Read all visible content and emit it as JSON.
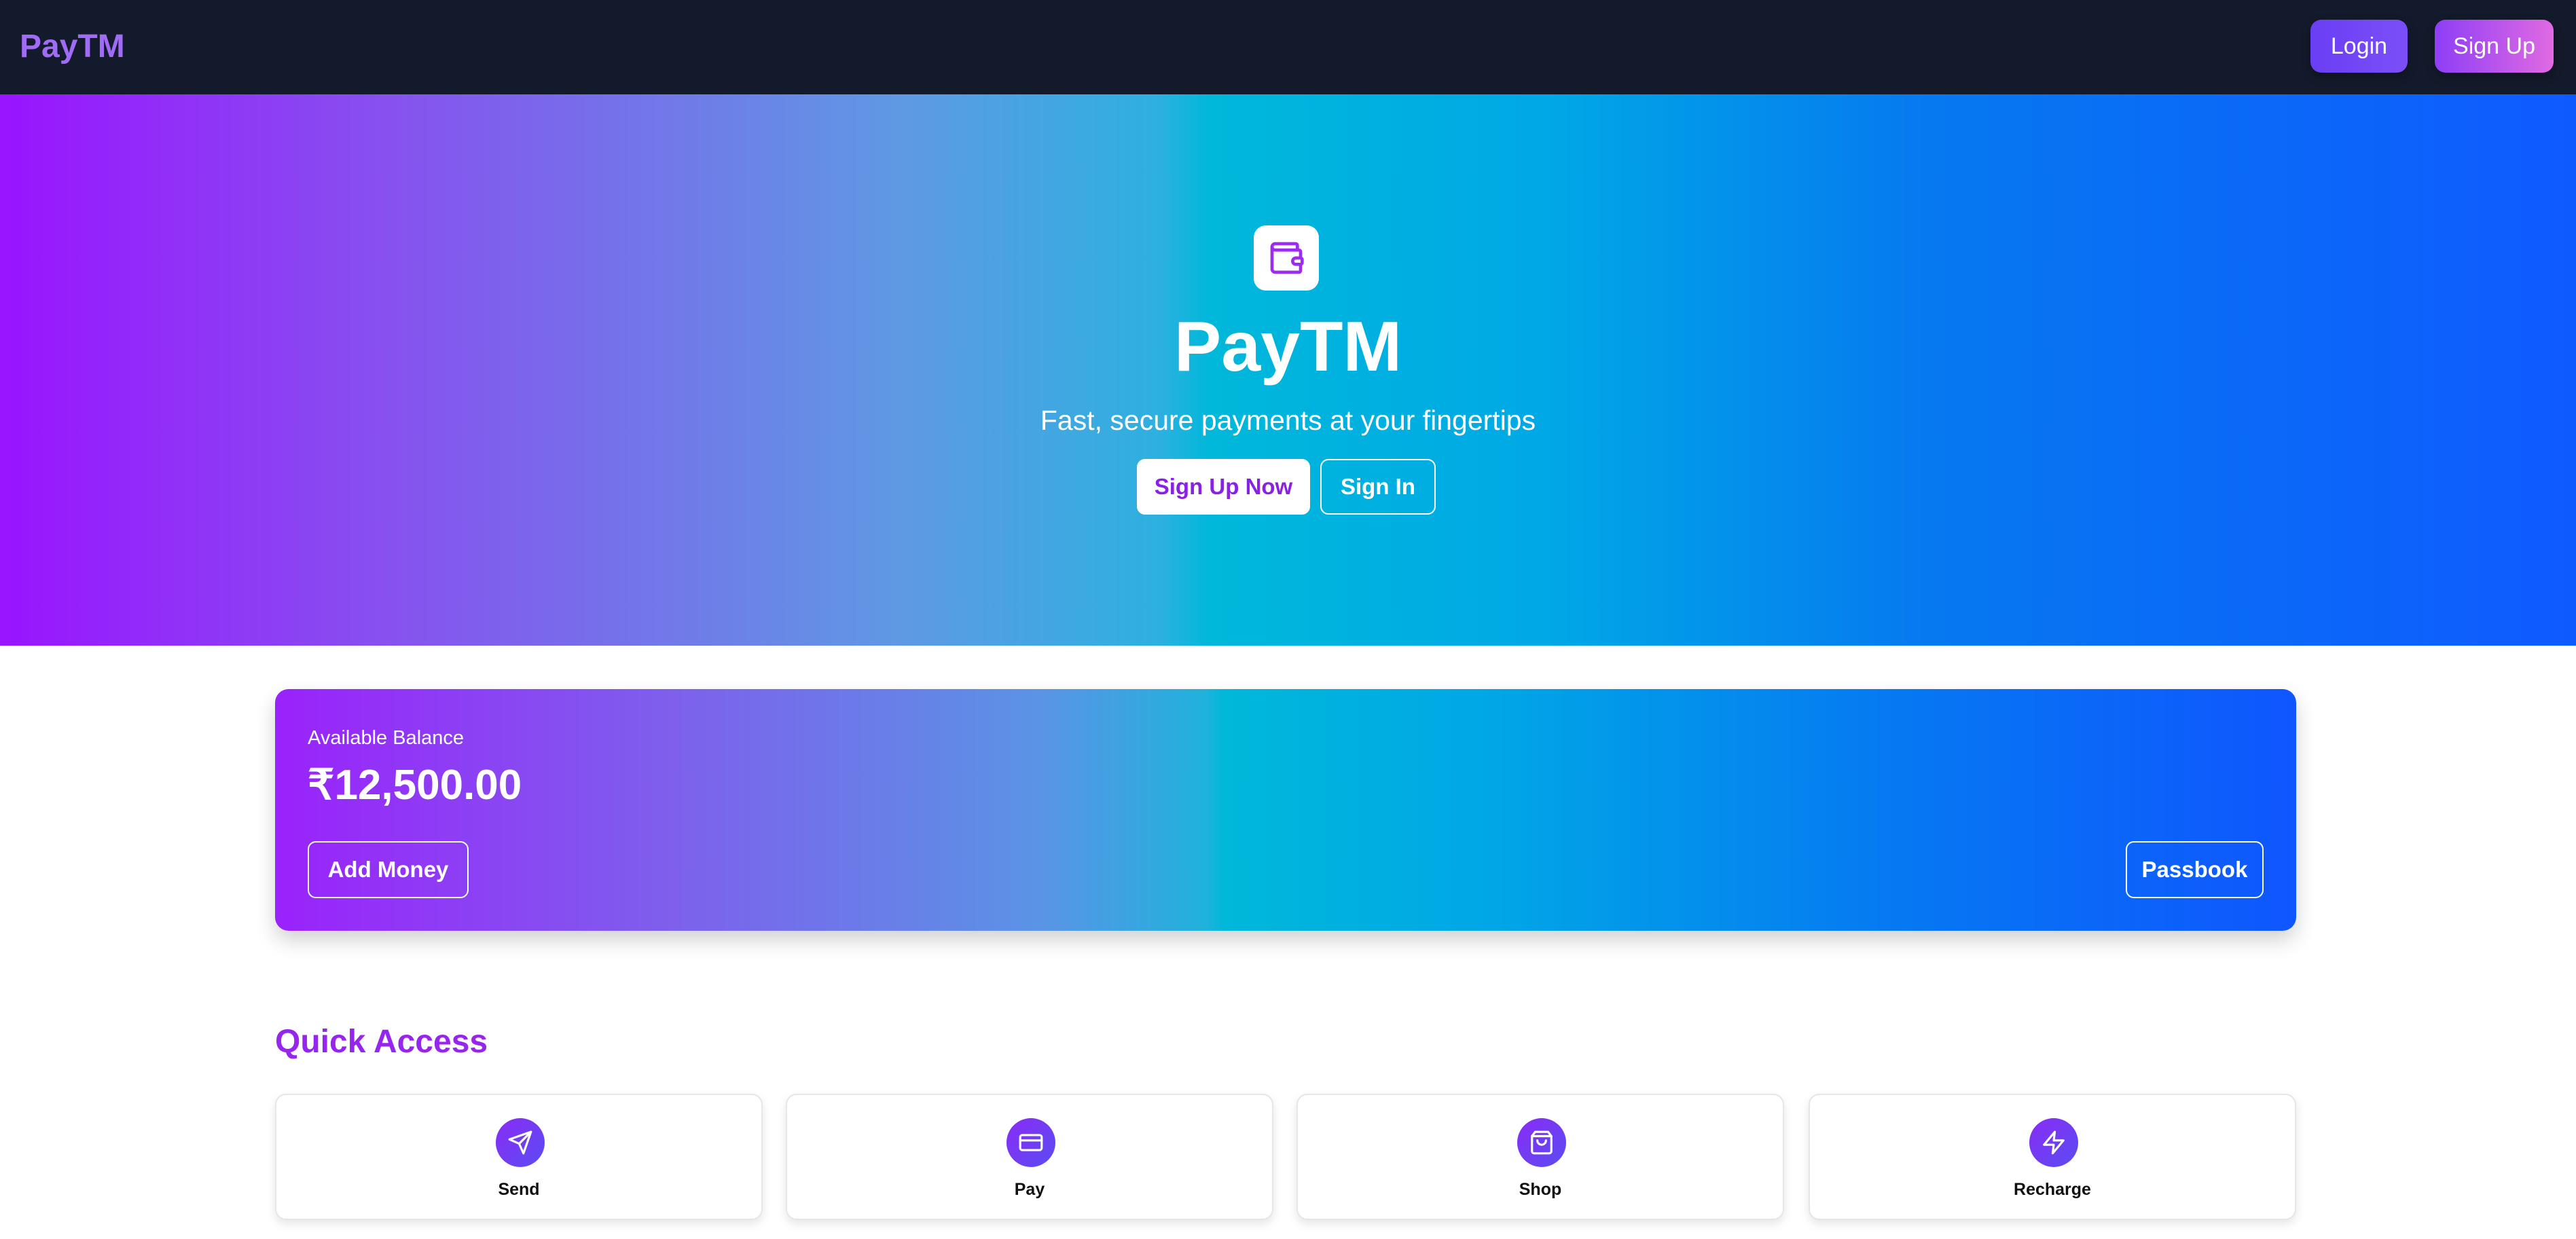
{
  "navbar": {
    "logo": "PayTM",
    "login_label": "Login",
    "signup_label": "Sign Up"
  },
  "hero": {
    "icon": "wallet-icon",
    "title": "PayTM",
    "subtitle": "Fast, secure payments at your fingertips",
    "signup_label": "Sign Up Now",
    "signin_label": "Sign In"
  },
  "balance": {
    "label": "Available Balance",
    "amount": "₹12,500.00",
    "add_money_label": "Add Money",
    "passbook_label": "Passbook"
  },
  "quick_access": {
    "title": "Quick Access",
    "items": [
      {
        "label": "Send",
        "icon": "send-icon"
      },
      {
        "label": "Pay",
        "icon": "credit-card-icon"
      },
      {
        "label": "Shop",
        "icon": "shopping-bag-icon"
      },
      {
        "label": "Recharge",
        "icon": "lightning-icon"
      }
    ]
  },
  "colors": {
    "navbar_bg": "#131a2b",
    "brand_purple": "#9626ee",
    "gradient_start": "#9914ff",
    "gradient_mid": "#00b8da",
    "gradient_end": "#0f5aff"
  }
}
